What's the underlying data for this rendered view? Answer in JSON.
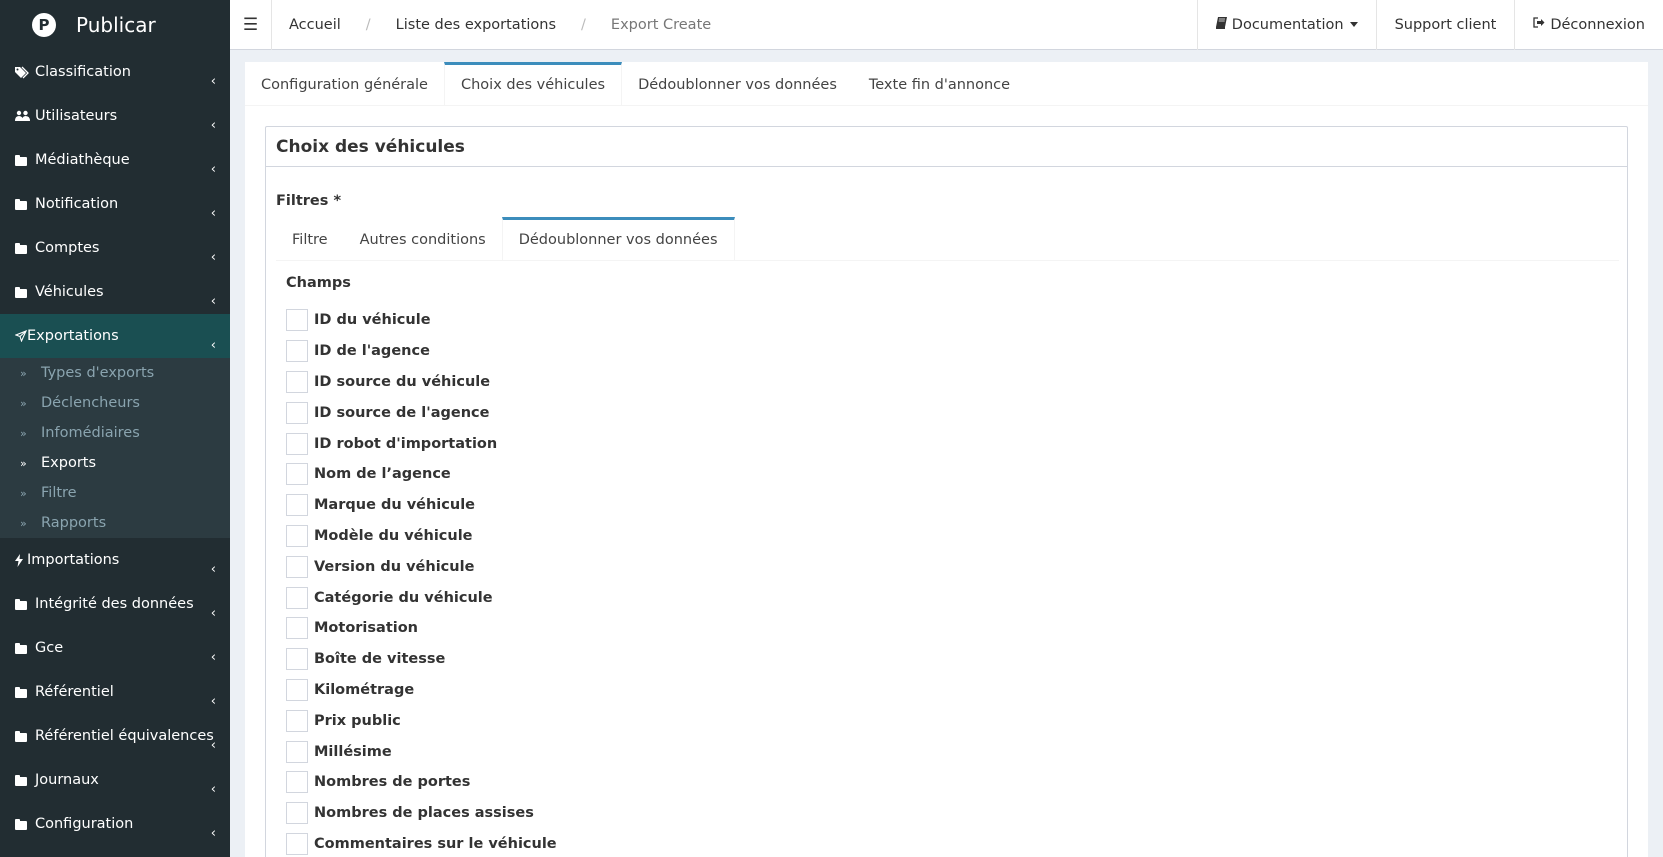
{
  "brand": {
    "logo": "P",
    "name": "Publicar"
  },
  "sidebar": {
    "items": [
      {
        "label": "Classification",
        "icon": "tags-icon"
      },
      {
        "label": "Utilisateurs",
        "icon": "users-icon"
      },
      {
        "label": "Médiathèque",
        "icon": "folder-icon"
      },
      {
        "label": "Notification",
        "icon": "folder-icon"
      },
      {
        "label": "Comptes",
        "icon": "folder-icon"
      },
      {
        "label": "Véhicules",
        "icon": "folder-icon"
      },
      {
        "label": "Exportations",
        "icon": "paper-plane-icon"
      },
      {
        "label": "Importations",
        "icon": "bolt-icon"
      },
      {
        "label": "Intégrité des données",
        "icon": "folder-icon"
      },
      {
        "label": "Gce",
        "icon": "folder-icon"
      },
      {
        "label": "Référentiel",
        "icon": "folder-icon"
      },
      {
        "label": "Référentiel équivalences",
        "icon": "folder-icon"
      },
      {
        "label": "Journaux",
        "icon": "folder-icon"
      },
      {
        "label": "Configuration",
        "icon": "folder-icon"
      }
    ],
    "submenu": [
      {
        "label": "Types d'exports"
      },
      {
        "label": "Déclencheurs"
      },
      {
        "label": "Infomédiaires"
      },
      {
        "label": "Exports"
      },
      {
        "label": "Filtre"
      },
      {
        "label": "Rapports"
      }
    ]
  },
  "topbar": {
    "breadcrumb": [
      "Accueil",
      "Liste des exportations",
      "Export Create"
    ],
    "separator": "/",
    "documentation": "Documentation",
    "support": "Support client",
    "logout": "Déconnexion"
  },
  "tabs": [
    "Configuration générale",
    "Choix des véhicules",
    "Dédoublonner vos données",
    "Texte fin d'annonce"
  ],
  "box": {
    "title": "Choix des véhicules",
    "filters_label": "Filtres *",
    "subtabs": [
      "Filtre",
      "Autres conditions",
      "Dédoublonner vos données"
    ],
    "champs_label": "Champs",
    "fields": [
      "ID du véhicule",
      "ID de l'agence",
      "ID source du véhicule",
      "ID source de l'agence",
      "ID robot d'importation",
      "Nom de l’agence",
      "Marque du véhicule",
      "Modèle du véhicule",
      "Version du véhicule",
      "Catégorie du véhicule",
      "Motorisation",
      "Boîte de vitesse",
      "Kilométrage",
      "Prix public",
      "Millésime",
      "Nombres de portes",
      "Nombres de places assises",
      "Commentaires sur le véhicule"
    ]
  },
  "colors": {
    "sidebar_bg": "#222d32",
    "sidebar_active": "#1a4f52",
    "submenu_bg": "#2c3b41",
    "tab_accent": "#3c8dbc"
  }
}
